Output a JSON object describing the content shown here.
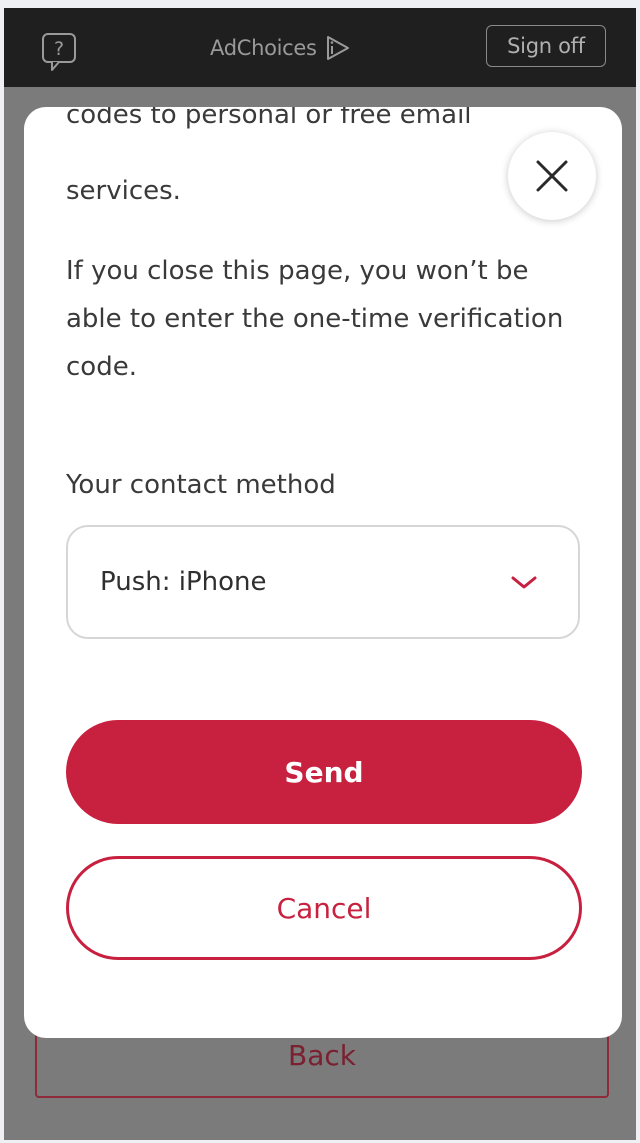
{
  "header": {
    "help_icon": "question-bubble-icon",
    "adchoices_label": "AdChoices",
    "adchoices_icon": "adchoices-triangle-icon",
    "signoff_label": "Sign off"
  },
  "background": {
    "back_label": "Back"
  },
  "modal": {
    "partial_line": "codes to personal or free email",
    "services_line": "services.",
    "close_icon": "close-icon",
    "warning_text": "If you close this page, you won’t be able to enter the one-time verification code.",
    "contact_label": "Your contact method",
    "contact_select_value": "Push: iPhone",
    "send_label": "Send",
    "cancel_label": "Cancel"
  },
  "colors": {
    "brand_red": "#c8203f",
    "topbar": "#1f1f1f",
    "overlay": "#7b7b7b"
  }
}
